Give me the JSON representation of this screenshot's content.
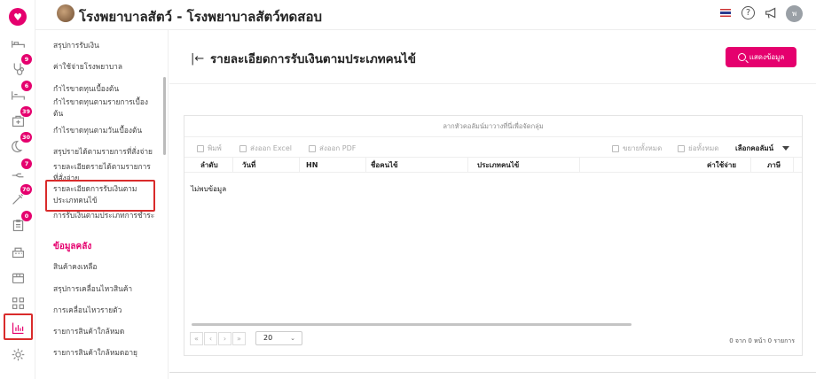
{
  "app": {
    "title": "โรงพยาบาลสัตว์ - โรงพยาบาลสัตว์ทดสอบ",
    "user_initial": "พ"
  },
  "rail": {
    "items": [
      {
        "icon": "bed-icon",
        "badge": ""
      },
      {
        "icon": "stethoscope-icon",
        "badge": "9"
      },
      {
        "icon": "clinic-bed-icon",
        "badge": "6"
      },
      {
        "icon": "medicine-box-icon",
        "badge": "39"
      },
      {
        "icon": "moon-icon",
        "badge": "30"
      },
      {
        "icon": "hand-icon",
        "badge": "7"
      },
      {
        "icon": "syringe-icon",
        "badge": "70"
      },
      {
        "icon": "clipboard-icon",
        "badge": "0"
      },
      {
        "icon": "cash-register-icon",
        "badge": ""
      },
      {
        "icon": "package-icon",
        "badge": ""
      },
      {
        "icon": "apps-grid-icon",
        "badge": ""
      },
      {
        "icon": "bar-chart-icon",
        "badge": ""
      },
      {
        "icon": "settings-icon",
        "badge": ""
      }
    ]
  },
  "submenu": {
    "links": [
      "สรุปการรับเงิน",
      "ค่าใช้จ่ายโรงพยาบาล",
      "กำไรขาดทุนเบื้องต้น",
      "กำไรขาดทุนตามรายการเบื้องต้น",
      "กำไรขาดทุนตามวันเบื้องต้น",
      "สรุปรายได้ตามรายการที่สั่งจ่าย",
      "รายละเอียดรายได้ตามรายการที่สั่งจ่าย",
      "รายละเอียดการรับเงินตามประเภทคนไข้",
      "การรับเงินตามประเภทการชำระ"
    ],
    "section_title": "ข้อมูลคลัง",
    "stock_links": [
      "สินค้าคงเหลือ",
      "สรุปการเคลื่อนไหวสินค้า",
      "การเคลื่อนไหวรายตัว",
      "รายการสินค้าใกล้หมด",
      "รายการสินค้าใกล้หมดอายุ"
    ]
  },
  "page": {
    "title": "รายละเอียดการรับเงินตามประเภทคนไข้",
    "show_button": "แสดงข้อมูล"
  },
  "grid": {
    "group_hint": "ลากหัวคอลัมน์มาวางที่นี่เพื่อจัดกลุ่ม",
    "toolbar": {
      "print": "พิมพ์",
      "export_excel": "ส่งออก Excel",
      "export_pdf": "ส่งออก PDF",
      "expand_all": "ขยายทั้งหมด",
      "collapse_all": "ย่อทั้งหมด",
      "choose_columns": "เลือกคอลัมน์"
    },
    "columns": [
      "ลำดับ",
      "วันที่",
      "HN",
      "ชื่อคนไข้",
      "ประเภทคนไข้",
      "ค่าใช้จ่าย",
      "ภาษี"
    ],
    "empty_message": "ไม่พบข้อมูล",
    "pager": {
      "first": "«",
      "prev": "‹",
      "next": "›",
      "last": "»",
      "page_size": "20",
      "info": "0 จาก 0 หน้า 0 รายการ"
    }
  },
  "colors": {
    "accent": "#e5006e",
    "highlight_border": "#d92b2b"
  }
}
